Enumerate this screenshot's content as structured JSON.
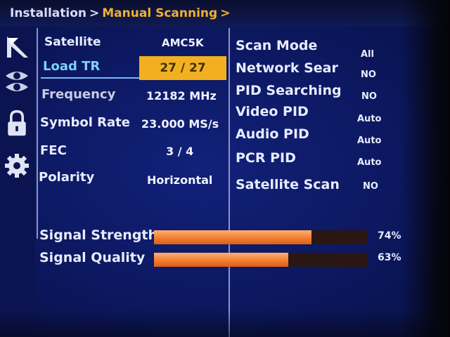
{
  "breadcrumb": {
    "parent": "Installation",
    "separator": ">",
    "current": "Manual Scanning",
    "trailing": ">"
  },
  "sidebar_icons": [
    "satellite-dish-icon",
    "eye-icon",
    "lock-icon",
    "gear-icon"
  ],
  "left_rows": [
    {
      "label": "Satellite",
      "value": "AMC5K"
    },
    {
      "label": "Load TR",
      "value": "27 / 27"
    },
    {
      "label": "Frequency",
      "value": "12182 MHz"
    },
    {
      "label": "Symbol Rate",
      "value": "23.000 MS/s"
    },
    {
      "label": "FEC",
      "value": "3 / 4"
    },
    {
      "label": "Polarity",
      "value": "Horizontal"
    }
  ],
  "right_rows": [
    {
      "label": "Scan Mode",
      "value": "All"
    },
    {
      "label": "Network Sear",
      "value": "NO"
    },
    {
      "label": "PID Searching",
      "value": "NO"
    },
    {
      "label": "Video PID",
      "value": "Auto"
    },
    {
      "label": "Audio PID",
      "value": "Auto"
    },
    {
      "label": "PCR PID",
      "value": "Auto"
    },
    {
      "label": "Satellite Scan",
      "value": "NO"
    }
  ],
  "signal": [
    {
      "label": "Signal Strength",
      "level": 74,
      "display": "74%"
    },
    {
      "label": "Signal Quality",
      "level": 63,
      "display": "63%"
    }
  ],
  "colors": {
    "highlight": "#f2b020",
    "accent_text": "#7fd0ff",
    "bar_fill": "#f07a2c",
    "background": "#0c1860"
  }
}
